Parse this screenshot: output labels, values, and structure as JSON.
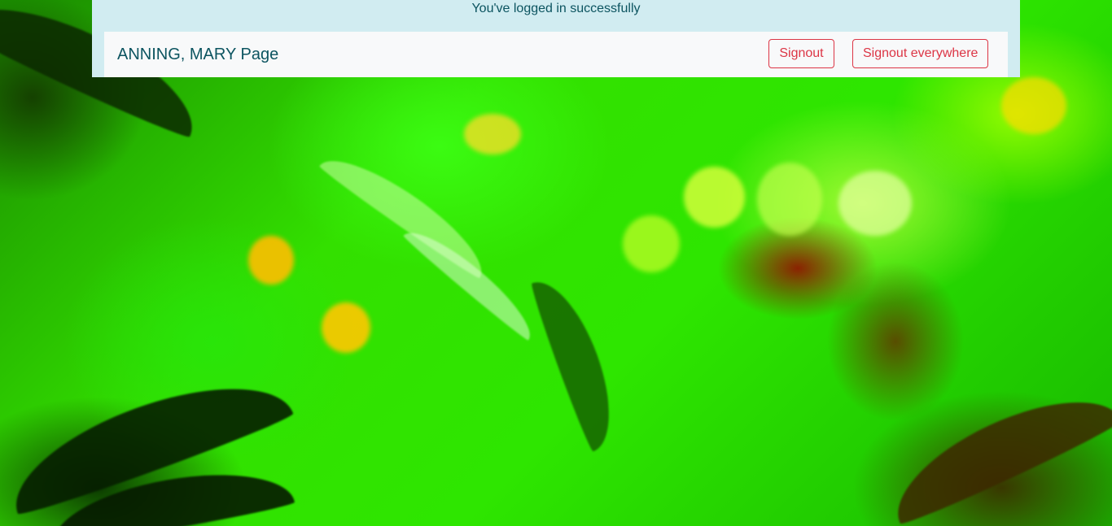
{
  "alert": {
    "message": "You've logged in successfully"
  },
  "navbar": {
    "brand": "ANNING, MARY Page",
    "signout_label": "Signout",
    "signout_everywhere_label": "Signout everywhere"
  },
  "colors": {
    "alert_background": "#d1ecf1",
    "alert_text": "#0c5460",
    "navbar_background": "#f8f9fa",
    "danger": "#dc3545"
  },
  "background": {
    "description_icon": "background-photo"
  }
}
